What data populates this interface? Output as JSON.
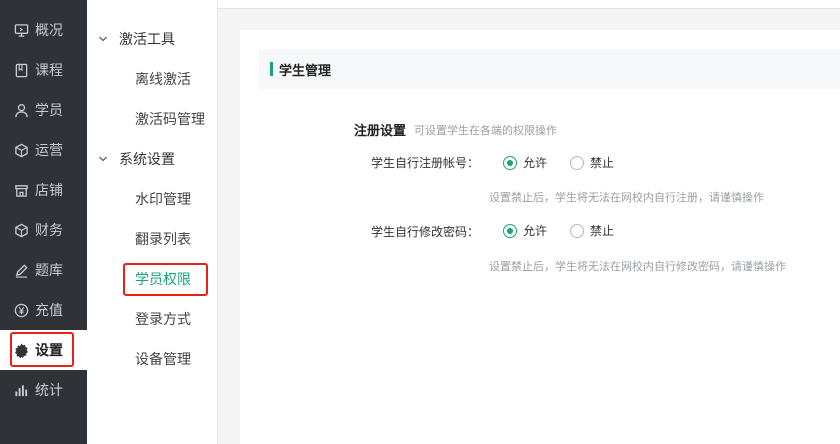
{
  "nav": {
    "items": [
      {
        "label": "概况",
        "icon": "monitor-icon"
      },
      {
        "label": "课程",
        "icon": "book-icon"
      },
      {
        "label": "学员",
        "icon": "user-icon"
      },
      {
        "label": "运营",
        "icon": "cube-icon"
      },
      {
        "label": "店铺",
        "icon": "store-icon"
      },
      {
        "label": "财务",
        "icon": "cube-icon"
      },
      {
        "label": "题库",
        "icon": "pen-icon"
      },
      {
        "label": "充值",
        "icon": "yen-icon"
      },
      {
        "label": "设置",
        "icon": "gear-icon"
      },
      {
        "label": "统计",
        "icon": "bar-chart-icon"
      }
    ],
    "active": "设置"
  },
  "subnav": {
    "groups": [
      {
        "label": "激活工具",
        "items": [
          "离线激活",
          "激活码管理"
        ]
      },
      {
        "label": "系统设置",
        "items": [
          "水印管理",
          "翻录列表",
          "学员权限",
          "登录方式",
          "设备管理"
        ]
      }
    ],
    "active": "学员权限"
  },
  "main": {
    "section_title": "学生管理",
    "register": {
      "title": "注册设置",
      "subtitle": "可设置学生在各端的权限操作",
      "rows": [
        {
          "label": "学生自行注册帐号：",
          "allow": "允许",
          "deny": "禁止",
          "selected": "允许",
          "hint": "设置禁止后，学生将无法在网校内自行注册，请谨慎操作"
        },
        {
          "label": "学生自行修改密码：",
          "allow": "允许",
          "deny": "禁止",
          "selected": "允许",
          "hint": "设置禁止后，学生将无法在网校内自行修改密码，请谨慎操作"
        }
      ]
    }
  },
  "colors": {
    "accent": "#1aa37a",
    "nav_bg": "#2f3338",
    "highlight_box": "#e8201a"
  }
}
